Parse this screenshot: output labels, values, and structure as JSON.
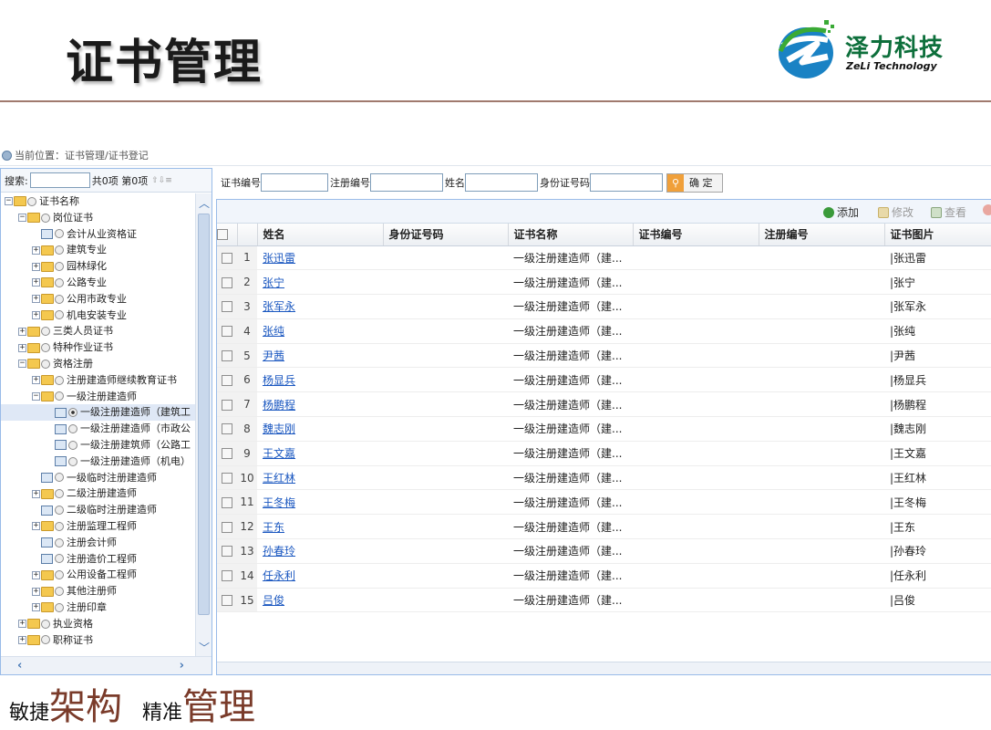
{
  "slide": {
    "title": "证书管理"
  },
  "logo": {
    "cn": "泽力科技",
    "en": "ZeLi Technology"
  },
  "breadcrumb": "当前位置：证书管理/证书登记",
  "left_panel": {
    "search_label": "搜索:",
    "search_value": "",
    "count_text": "共0项 第0项"
  },
  "tree": [
    {
      "label": "证书名称",
      "depth": 0,
      "kind": "folder",
      "toggle": "−",
      "open": true
    },
    {
      "label": "岗位证书",
      "depth": 1,
      "kind": "folder",
      "toggle": "−"
    },
    {
      "label": "会计从业资格证",
      "depth": 2,
      "kind": "leaf"
    },
    {
      "label": "建筑专业",
      "depth": 2,
      "kind": "folder",
      "toggle": "+"
    },
    {
      "label": "园林绿化",
      "depth": 2,
      "kind": "folder",
      "toggle": "+"
    },
    {
      "label": "公路专业",
      "depth": 2,
      "kind": "folder",
      "toggle": "+"
    },
    {
      "label": "公用市政专业",
      "depth": 2,
      "kind": "folder",
      "toggle": "+"
    },
    {
      "label": "机电安装专业",
      "depth": 2,
      "kind": "folder",
      "toggle": "+"
    },
    {
      "label": "三类人员证书",
      "depth": 1,
      "kind": "folder",
      "toggle": "+"
    },
    {
      "label": "特种作业证书",
      "depth": 1,
      "kind": "folder",
      "toggle": "+"
    },
    {
      "label": "资格注册",
      "depth": 1,
      "kind": "folder",
      "toggle": "−"
    },
    {
      "label": "注册建造师继续教育证书",
      "depth": 2,
      "kind": "folder",
      "toggle": "+"
    },
    {
      "label": "一级注册建造师",
      "depth": 2,
      "kind": "folder",
      "toggle": "−"
    },
    {
      "label": "一级注册建造师（建筑工",
      "depth": 3,
      "kind": "leaf",
      "selected": true
    },
    {
      "label": "一级注册建造师（市政公",
      "depth": 3,
      "kind": "leaf"
    },
    {
      "label": "一级注册建筑师（公路工",
      "depth": 3,
      "kind": "leaf"
    },
    {
      "label": "一级注册建造师（机电）",
      "depth": 3,
      "kind": "leaf"
    },
    {
      "label": "一级临时注册建造师",
      "depth": 2,
      "kind": "leaf"
    },
    {
      "label": "二级注册建造师",
      "depth": 2,
      "kind": "folder",
      "toggle": "+"
    },
    {
      "label": "二级临时注册建造师",
      "depth": 2,
      "kind": "leaf"
    },
    {
      "label": "注册监理工程师",
      "depth": 2,
      "kind": "folder",
      "toggle": "+"
    },
    {
      "label": "注册会计师",
      "depth": 2,
      "kind": "leaf"
    },
    {
      "label": "注册造价工程师",
      "depth": 2,
      "kind": "leaf"
    },
    {
      "label": "公用设备工程师",
      "depth": 2,
      "kind": "folder",
      "toggle": "+"
    },
    {
      "label": "其他注册师",
      "depth": 2,
      "kind": "folder",
      "toggle": "+"
    },
    {
      "label": "注册印章",
      "depth": 2,
      "kind": "folder",
      "toggle": "+"
    },
    {
      "label": "执业资格",
      "depth": 1,
      "kind": "folder",
      "toggle": "+"
    },
    {
      "label": "职称证书",
      "depth": 1,
      "kind": "folder",
      "toggle": "+"
    }
  ],
  "search": {
    "cert_no_label": "证书编号",
    "reg_no_label": "注册编号",
    "name_label": "姓名",
    "id_label": "身份证号码",
    "ok_label": "确 定"
  },
  "toolbar": {
    "add": "添加",
    "edit": "修改",
    "view": "查看"
  },
  "columns": [
    "姓名",
    "身份证号码",
    "证书名称",
    "证书编号",
    "注册编号",
    "证书图片"
  ],
  "rows": [
    {
      "n": "1",
      "name": "张迅雷",
      "id": "",
      "cert": "一级注册建造师（建...",
      "cert_no": "",
      "reg_no": "",
      "pic": "|张迅雷"
    },
    {
      "n": "2",
      "name": "张宁",
      "id": "",
      "cert": "一级注册建造师（建...",
      "cert_no": "",
      "reg_no": "",
      "pic": "|张宁"
    },
    {
      "n": "3",
      "name": "张军永",
      "id": "",
      "cert": "一级注册建造师（建...",
      "cert_no": "",
      "reg_no": "",
      "pic": "|张军永"
    },
    {
      "n": "4",
      "name": "张纯",
      "id": "",
      "cert": "一级注册建造师（建...",
      "cert_no": "",
      "reg_no": "",
      "pic": "|张纯"
    },
    {
      "n": "5",
      "name": "尹茜",
      "id": "",
      "cert": "一级注册建造师（建...",
      "cert_no": "",
      "reg_no": "",
      "pic": "|尹茜"
    },
    {
      "n": "6",
      "name": "杨显兵",
      "id": "",
      "cert": "一级注册建造师（建...",
      "cert_no": "",
      "reg_no": "",
      "pic": "|杨显兵"
    },
    {
      "n": "7",
      "name": "杨鹏程",
      "id": "",
      "cert": "一级注册建造师（建...",
      "cert_no": "",
      "reg_no": "",
      "pic": "|杨鹏程"
    },
    {
      "n": "8",
      "name": "魏志刚",
      "id": "",
      "cert": "一级注册建造师（建...",
      "cert_no": "",
      "reg_no": "",
      "pic": "|魏志刚"
    },
    {
      "n": "9",
      "name": "王文嘉",
      "id": "",
      "cert": "一级注册建造师（建...",
      "cert_no": "",
      "reg_no": "",
      "pic": "|王文嘉"
    },
    {
      "n": "10",
      "name": "王红林",
      "id": "",
      "cert": "一级注册建造师（建...",
      "cert_no": "",
      "reg_no": "",
      "pic": "|王红林"
    },
    {
      "n": "11",
      "name": "王冬梅",
      "id": "",
      "cert": "一级注册建造师（建...",
      "cert_no": "",
      "reg_no": "",
      "pic": "|王冬梅"
    },
    {
      "n": "12",
      "name": "王东",
      "id": "",
      "cert": "一级注册建造师（建...",
      "cert_no": "",
      "reg_no": "",
      "pic": "|王东"
    },
    {
      "n": "13",
      "name": "孙春玲",
      "id": "",
      "cert": "一级注册建造师（建...",
      "cert_no": "",
      "reg_no": "",
      "pic": "|孙春玲"
    },
    {
      "n": "14",
      "name": "任永利",
      "id": "",
      "cert": "一级注册建造师（建...",
      "cert_no": "",
      "reg_no": "",
      "pic": "|任永利"
    },
    {
      "n": "15",
      "name": "吕俊",
      "id": "",
      "cert": "一级注册建造师（建...",
      "cert_no": "",
      "reg_no": "",
      "pic": "|吕俊"
    }
  ],
  "footer": {
    "small1": "敏捷",
    "big1": "架构",
    "small2": "精准",
    "big2": "管理"
  },
  "colors": {
    "title_shadow": "#b8b8b8",
    "logo_green": "#0d6f3b",
    "logo_blue": "#1a82c4",
    "link": "#1a57c0",
    "rule": "#a07a6e",
    "footer_accent": "#7a3b2a"
  }
}
